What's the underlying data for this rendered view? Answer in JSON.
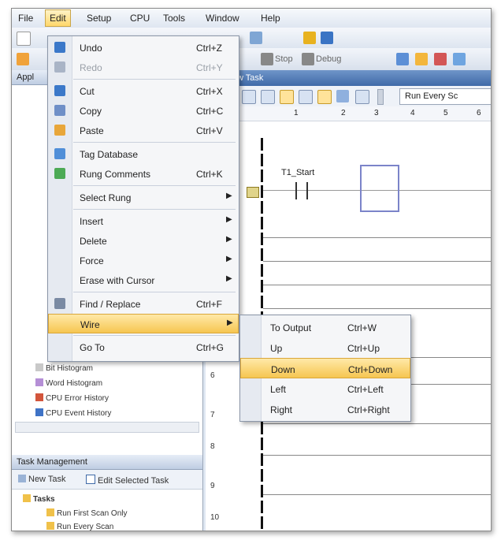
{
  "menubar": {
    "items": [
      {
        "label": "File"
      },
      {
        "label": "Edit"
      },
      {
        "label": "Setup"
      },
      {
        "label": "CPU"
      },
      {
        "label": "Tools"
      },
      {
        "label": "Window"
      },
      {
        "label": "Help"
      }
    ]
  },
  "toolbar2": {
    "stop_label": "Stop",
    "debug_label": "Debug"
  },
  "left_panel": {
    "header_partial": "Appl",
    "tree_items": [
      {
        "label": "Bit Histogram",
        "icon": "chart-icon"
      },
      {
        "label": "Word Histogram",
        "icon": "chart-icon"
      },
      {
        "label": "CPU Error History",
        "icon": "error-icon"
      },
      {
        "label": "CPU Event History",
        "icon": "event-icon"
      }
    ],
    "task_management": {
      "title": "Task Management",
      "new_task": "New Task",
      "edit_selected_task": "Edit Selected Task",
      "tasks_root": "Tasks",
      "task_items": [
        "Run First Scan Only",
        "Run Every Scan"
      ]
    }
  },
  "editor": {
    "tab_title": "w Task",
    "run_mode": "Run Every Sc",
    "columns": [
      "1",
      "2",
      "3",
      "4",
      "5",
      "6"
    ],
    "contact_label": "T1_Start",
    "rung_numbers": [
      "6",
      "7",
      "8",
      "9",
      "10"
    ]
  },
  "edit_menu": {
    "items": [
      {
        "label": "Undo",
        "shortcut": "Ctrl+Z",
        "icon": "undo-icon"
      },
      {
        "label": "Redo",
        "shortcut": "Ctrl+Y",
        "icon": "redo-icon",
        "disabled": true
      },
      {
        "label": "Cut",
        "shortcut": "Ctrl+X",
        "icon": "cut-icon"
      },
      {
        "label": "Copy",
        "shortcut": "Ctrl+C",
        "icon": "copy-icon"
      },
      {
        "label": "Paste",
        "shortcut": "Ctrl+V",
        "icon": "paste-icon"
      },
      {
        "label": "Tag Database",
        "shortcut": "",
        "icon": "database-icon"
      },
      {
        "label": "Rung Comments",
        "shortcut": "Ctrl+K",
        "icon": "comment-icon"
      },
      {
        "label": "Select Rung",
        "shortcut": "",
        "submenu": true
      },
      {
        "label": "Insert",
        "shortcut": "",
        "submenu": true
      },
      {
        "label": "Delete",
        "shortcut": "",
        "submenu": true
      },
      {
        "label": "Force",
        "shortcut": "",
        "submenu": true
      },
      {
        "label": "Erase with Cursor",
        "shortcut": "",
        "submenu": true
      },
      {
        "label": "Find / Replace",
        "shortcut": "Ctrl+F",
        "icon": "find-icon"
      },
      {
        "label": "Wire",
        "shortcut": "",
        "submenu": true,
        "highlighted": true
      },
      {
        "label": "Go To",
        "shortcut": "Ctrl+G"
      }
    ]
  },
  "wire_submenu": {
    "items": [
      {
        "label": "To Output",
        "shortcut": "Ctrl+W"
      },
      {
        "label": "Up",
        "shortcut": "Ctrl+Up"
      },
      {
        "label": "Down",
        "shortcut": "Ctrl+Down",
        "highlighted": true
      },
      {
        "label": "Left",
        "shortcut": "Ctrl+Left"
      },
      {
        "label": "Right",
        "shortcut": "Ctrl+Right"
      }
    ]
  },
  "colors": {
    "highlight": "#f6c651",
    "accent": "#3f6aa8"
  }
}
